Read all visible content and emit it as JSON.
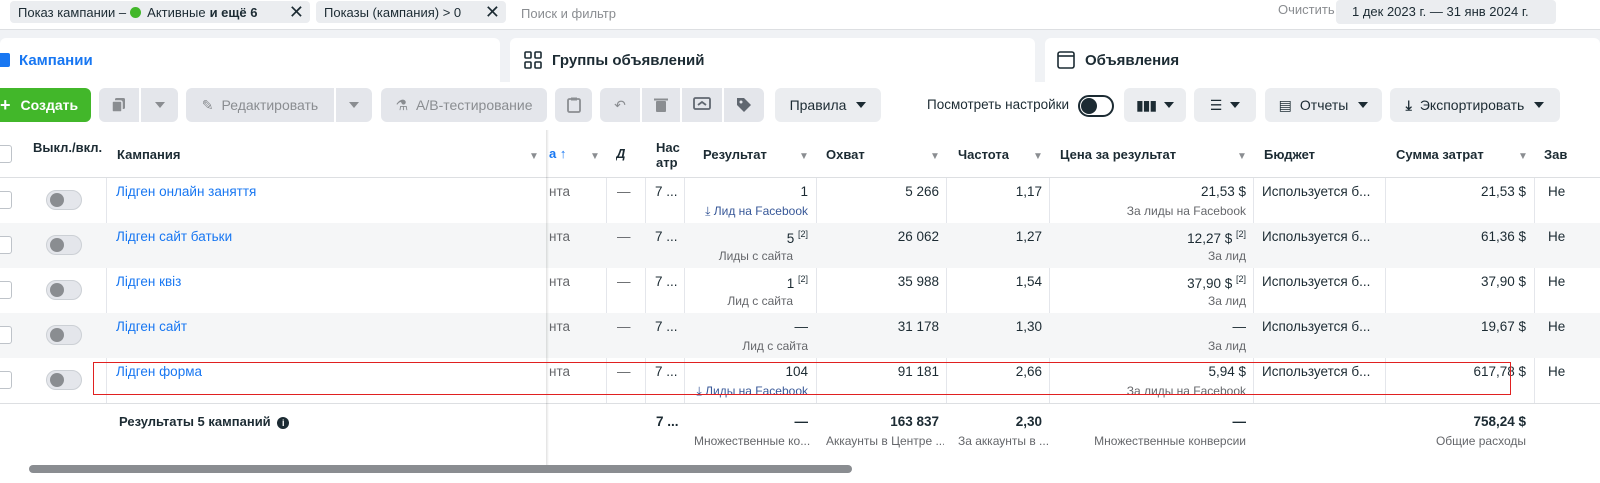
{
  "filters": {
    "chip1_prefix": "Показ кампании –",
    "chip1_status": "Активные",
    "chip1_more": "и ещё 6",
    "chip2": "Показы (кампания) > 0",
    "search_placeholder": "Поиск и фильтр",
    "clear": "Очистить",
    "date_range": "1 дек 2023 г. — 31 янв 2024 г."
  },
  "tabs": {
    "campaigns": "Кампании",
    "adsets": "Группы объявлений",
    "ads": "Объявления"
  },
  "toolbar": {
    "create": "Создать",
    "edit": "Редактировать",
    "ab_test": "A/B-тестирование",
    "rules": "Правила",
    "view_settings": "Посмотреть настройки",
    "reports": "Отчеты",
    "export": "Экспортировать"
  },
  "columns": {
    "toggle": "Выкл./вкл.",
    "campaign": "Кампания",
    "sorted": "а",
    "narrow1": "Д",
    "narrow2": "Нас атр",
    "result": "Результат",
    "reach": "Охват",
    "frequency": "Частота",
    "cost_per_result": "Цена за результат",
    "budget": "Бюджет",
    "spent": "Сумма затрат",
    "last": "Зав"
  },
  "rows": [
    {
      "name": "Лідген онлайн заняття",
      "c1": "нта",
      "c2": "—",
      "c3": "7 ...",
      "result": "1",
      "result_sub": "Лид на Facebook",
      "reach": "5 266",
      "freq": "1,17",
      "cpr": "21,53 $",
      "cpr_sub": "За лиды на Facebook",
      "budget": "Используется б...",
      "spent": "21,53 $",
      "last": "Не"
    },
    {
      "name": "Лідген сайт батьки",
      "c1": "нта",
      "c2": "—",
      "c3": "7 ...",
      "result": "5",
      "result_sup": "[2]",
      "result_sub": "Лиды с сайта",
      "reach": "26 062",
      "freq": "1,27",
      "cpr": "12,27 $",
      "cpr_sup": "[2]",
      "cpr_sub": "За лид",
      "budget": "Используется б...",
      "spent": "61,36 $",
      "last": "Не"
    },
    {
      "name": "Лідген квіз",
      "c1": "нта",
      "c2": "—",
      "c3": "7 ...",
      "result": "1",
      "result_sup": "[2]",
      "result_sub": "Лид с сайта",
      "reach": "35 988",
      "freq": "1,54",
      "cpr": "37,90 $",
      "cpr_sup": "[2]",
      "cpr_sub": "За лид",
      "budget": "Используется б...",
      "spent": "37,90 $",
      "last": "Не"
    },
    {
      "name": "Лідген сайт",
      "c1": "нта",
      "c2": "—",
      "c3": "7 ...",
      "result": "—",
      "result_sub": "Лид с сайта",
      "reach": "31 178",
      "freq": "1,30",
      "cpr": "—",
      "cpr_sub": "За лид",
      "budget": "Используется б...",
      "spent": "19,67 $",
      "last": "Не"
    },
    {
      "name": "Лідген форма",
      "c1": "нта",
      "c2": "—",
      "c3": "7 ...",
      "result": "104",
      "result_sub": "Лиды на Facebook",
      "reach": "91 181",
      "freq": "2,66",
      "cpr": "5,94 $",
      "cpr_sub": "За лиды на Facebook",
      "budget": "Используется б...",
      "spent": "617,78 $",
      "last": "Не"
    }
  ],
  "totals": {
    "label": "Результаты 5 кампаний",
    "c3": "7 ...",
    "result": "—",
    "result_sub": "Множественные ко...",
    "reach": "163 837",
    "reach_sub": "Аккаунты в Центре ...",
    "freq": "2,30",
    "freq_sub": "За аккаунты в ...",
    "cpr": "—",
    "cpr_sub": "Множественные конверсии",
    "spent": "758,24 $",
    "spent_sub": "Общие расходы"
  },
  "colors": {
    "accent": "#1877f2",
    "create": "#42b72a",
    "highlight": "#e02020"
  }
}
